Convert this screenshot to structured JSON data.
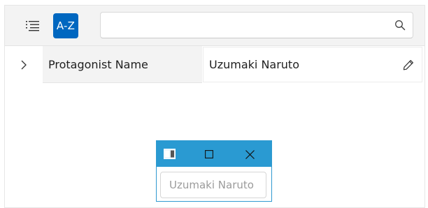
{
  "toolbar": {
    "list_icon": "list-icon",
    "sort_label": "A-Z",
    "search_value": "",
    "search_icon": "search-icon",
    "accent_color": "#0067c0"
  },
  "row": {
    "expander_icon": "chevron-right-icon",
    "property_name": "Protagonist Name",
    "property_value": "Uzumaki Naruto",
    "edit_icon": "pencil-icon"
  },
  "editor_window": {
    "titlebar_color": "#2a9ad2",
    "window_icon": "app-window-icon",
    "maximize_icon": "maximize-icon",
    "close_icon": "close-icon",
    "input_value": "Uzumaki Naruto"
  }
}
